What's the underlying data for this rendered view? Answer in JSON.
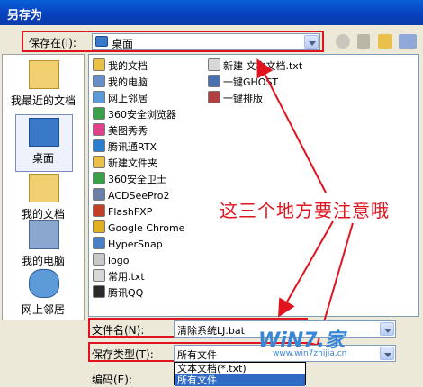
{
  "window": {
    "title": "另存为"
  },
  "save_in": {
    "label": "保存在(I):",
    "value": "桌面"
  },
  "places": [
    {
      "label": "我最近的文档",
      "icon": "recent-documents-icon"
    },
    {
      "label": "桌面",
      "icon": "desktop-icon"
    },
    {
      "label": "我的文档",
      "icon": "my-documents-icon"
    },
    {
      "label": "我的电脑",
      "icon": "my-computer-icon"
    },
    {
      "label": "网上邻居",
      "icon": "network-places-icon"
    }
  ],
  "files_col1": [
    {
      "name": "我的文档",
      "icon": "folder-icon",
      "color": "#e8c04a"
    },
    {
      "name": "我的电脑",
      "icon": "computer-icon",
      "color": "#6a8fc8"
    },
    {
      "name": "网上邻居",
      "icon": "network-icon",
      "color": "#5c9ad8"
    },
    {
      "name": "360安全浏览器",
      "icon": "browser-icon",
      "color": "#3aa14a"
    },
    {
      "name": "美图秀秀",
      "icon": "app-icon",
      "color": "#e0408a"
    },
    {
      "name": "腾讯通RTX",
      "icon": "app-icon",
      "color": "#2a7fd0"
    },
    {
      "name": "新建文件夹",
      "icon": "folder-icon",
      "color": "#e8c04a"
    },
    {
      "name": "360安全卫士",
      "icon": "shield-icon",
      "color": "#3aa14a"
    },
    {
      "name": "ACDSeePro2",
      "icon": "app-icon",
      "color": "#6a7fa8"
    },
    {
      "name": "FlashFXP",
      "icon": "app-icon",
      "color": "#c0402a"
    },
    {
      "name": "Google Chrome",
      "icon": "chrome-icon",
      "color": "#e0b020"
    },
    {
      "name": "HyperSnap",
      "icon": "app-icon",
      "color": "#4a80c8"
    },
    {
      "name": "logo",
      "icon": "file-icon",
      "color": "#c8c8c8"
    },
    {
      "name": "常用.txt",
      "icon": "text-file-icon",
      "color": "#d8d8d8"
    },
    {
      "name": "腾讯QQ",
      "icon": "qq-icon",
      "color": "#2a2a2a"
    }
  ],
  "files_col2": [
    {
      "name": "新建 文本文档.txt",
      "icon": "text-file-icon",
      "color": "#d8d8d8"
    },
    {
      "name": "一键GHOST",
      "icon": "app-icon",
      "color": "#4a70b0"
    },
    {
      "name": "一键排版",
      "icon": "app-icon",
      "color": "#b04040"
    }
  ],
  "filename": {
    "label": "文件名(N):",
    "value": "清除系统LJ.bat"
  },
  "filetype": {
    "label": "保存类型(T):",
    "value": "所有文件"
  },
  "filetype_options": [
    "文本文档(*.txt)",
    "所有文件"
  ],
  "encoding": {
    "label": "编码(E):"
  },
  "annotation": "这三个地方要注意哦",
  "watermark": {
    "logo": "WiN7.家",
    "url": "www.win7zhijia.cn"
  }
}
